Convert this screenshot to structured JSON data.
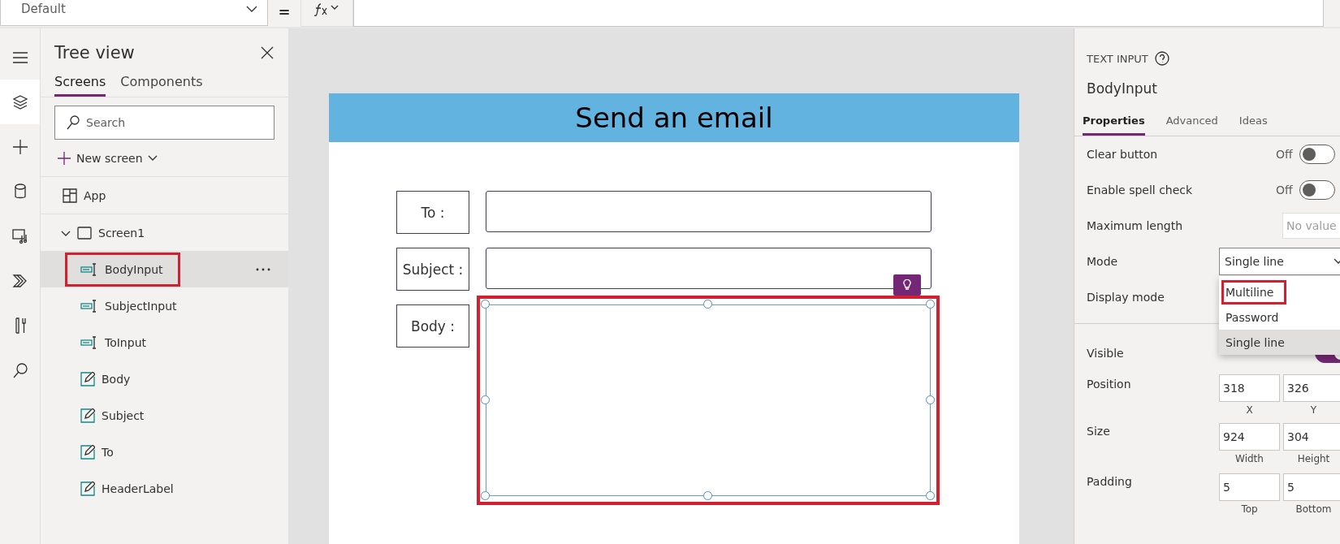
{
  "formula_bar": {
    "property": "Default",
    "operator": "="
  },
  "rail": [
    {
      "kind": "menu",
      "selected": false
    },
    {
      "kind": "layers",
      "selected": true
    },
    {
      "kind": "add",
      "selected": false
    },
    {
      "kind": "data",
      "selected": false
    },
    {
      "kind": "media",
      "selected": false
    },
    {
      "kind": "flow",
      "selected": false
    },
    {
      "kind": "tools",
      "selected": false
    },
    {
      "kind": "search",
      "selected": false
    }
  ],
  "tree_view": {
    "title": "Tree view",
    "tabs": [
      {
        "label": "Screens",
        "selected": true
      },
      {
        "label": "Components",
        "selected": false
      }
    ],
    "search": {
      "placeholder": "Search"
    },
    "new_screen": "New screen",
    "items": [
      {
        "label": "App",
        "kind": "app",
        "selected": false,
        "highlighted": false
      },
      {
        "label": "Screen1",
        "kind": "screen",
        "selected": false,
        "highlighted": false,
        "expanded": true,
        "children": [
          {
            "label": "BodyInput",
            "kind": "input",
            "selected": true,
            "highlighted": true
          },
          {
            "label": "SubjectInput",
            "kind": "input",
            "selected": false,
            "highlighted": false
          },
          {
            "label": "ToInput",
            "kind": "input",
            "selected": false,
            "highlighted": false
          },
          {
            "label": "Body",
            "kind": "label",
            "selected": false,
            "highlighted": false
          },
          {
            "label": "Subject",
            "kind": "label",
            "selected": false,
            "highlighted": false
          },
          {
            "label": "To",
            "kind": "label",
            "selected": false,
            "highlighted": false
          },
          {
            "label": "HeaderLabel",
            "kind": "label",
            "selected": false,
            "highlighted": false
          }
        ]
      }
    ]
  },
  "canvas": {
    "header": "Send an email",
    "fields": [
      {
        "label": "To :",
        "kind": "line",
        "selected": false
      },
      {
        "label": "Subject :",
        "kind": "line",
        "selected": false
      },
      {
        "label": "Body :",
        "kind": "box",
        "selected": true
      }
    ]
  },
  "properties": {
    "control_type": "TEXT INPUT",
    "name": "BodyInput",
    "tabs": [
      {
        "label": "Properties",
        "selected": true
      },
      {
        "label": "Advanced",
        "selected": false
      },
      {
        "label": "Ideas",
        "selected": false
      }
    ],
    "rows": [
      {
        "label": "Clear button",
        "kind": "toggle",
        "value": "Off",
        "on": false
      },
      {
        "label": "Enable spell check",
        "kind": "toggle",
        "value": "Off",
        "on": false
      },
      {
        "label": "Maximum length",
        "kind": "input",
        "placeholder": "No value"
      },
      {
        "label": "Mode",
        "kind": "select",
        "value": "Single line",
        "expanded": true,
        "options": [
          {
            "label": "Multiline",
            "selected": false,
            "highlighted": true
          },
          {
            "label": "Password",
            "selected": false,
            "highlighted": false
          },
          {
            "label": "Single line",
            "selected": true,
            "highlighted": false
          }
        ]
      },
      {
        "label": "Display mode",
        "kind": "blank"
      }
    ],
    "layout_rows": [
      {
        "label": "Visible",
        "kind": "toggle",
        "on": true
      },
      {
        "label": "Position",
        "kind": "pair",
        "values": [
          {
            "value": "318",
            "caption": "X"
          },
          {
            "value": "326",
            "caption": "Y"
          }
        ]
      },
      {
        "label": "Size",
        "kind": "pair",
        "values": [
          {
            "value": "924",
            "caption": "Width"
          },
          {
            "value": "304",
            "caption": "Height"
          }
        ]
      },
      {
        "label": "Padding",
        "kind": "pair",
        "values": [
          {
            "value": "5",
            "caption": "Top"
          },
          {
            "value": "5",
            "caption": "Bottom"
          }
        ]
      }
    ]
  }
}
